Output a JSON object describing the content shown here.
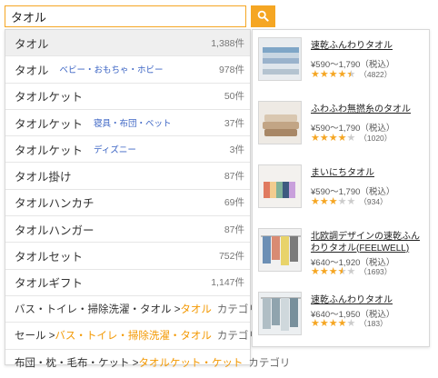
{
  "search": {
    "value": "タオル",
    "button_icon": "search-icon",
    "accent": "#f5a623"
  },
  "suggestions": [
    {
      "name": "タオル",
      "sub": "",
      "count": "1,388件"
    },
    {
      "name": "タオル",
      "sub": "ベビー・おもちゃ・ホビー",
      "count": "978件"
    },
    {
      "name": "タオルケット",
      "sub": "",
      "count": "50件"
    },
    {
      "name": "タオルケット",
      "sub": "寝具・布団・ベット",
      "count": "37件"
    },
    {
      "name": "タオルケット",
      "sub": "ディズニー",
      "count": "3件"
    },
    {
      "name": "タオル掛け",
      "sub": "",
      "count": "87件"
    },
    {
      "name": "タオルハンカチ",
      "sub": "",
      "count": "69件"
    },
    {
      "name": "タオルハンガー",
      "sub": "",
      "count": "87件"
    },
    {
      "name": "タオルセット",
      "sub": "",
      "count": "752件"
    },
    {
      "name": "タオルギフト",
      "sub": "",
      "count": "1,147件"
    }
  ],
  "categories": [
    {
      "path": "バス・トイレ・掃除洗濯・タオル > ",
      "highlight": "タオル",
      "suffix": "カテゴリ"
    },
    {
      "path": "セール > ",
      "highlight": "バス・トイレ・掃除洗濯・タオル",
      "suffix": "カテゴリ"
    },
    {
      "path": "布団・枕・毛布・ケット > ",
      "highlight": "タオルケット・ケット",
      "suffix": "カテゴリ"
    }
  ],
  "products": [
    {
      "title": "速乾ふんわりタオル",
      "price": "¥590〜1,790（税込）",
      "rating": 4.5,
      "reviews": "（4822）"
    },
    {
      "title": "ふわふわ無撚糸のタオル",
      "price": "¥590〜1,790（税込）",
      "rating": 4,
      "reviews": "（1020）"
    },
    {
      "title": "まいにちタオル",
      "price": "¥590〜1,790（税込）",
      "rating": 3,
      "reviews": "（934）"
    },
    {
      "title": "北欧調デザインの速乾ふんわりタオル(FEELWELL)",
      "price": "¥640〜1,920（税込）",
      "rating": 3.5,
      "reviews": "（1693）"
    },
    {
      "title": "速乾ふんわりタオル",
      "price": "¥640〜1,950（税込）",
      "rating": 4,
      "reviews": "（183）"
    }
  ],
  "colors": {
    "highlight": "#f39800",
    "sub_category": "#3b64c4",
    "star": "#f5a623"
  }
}
